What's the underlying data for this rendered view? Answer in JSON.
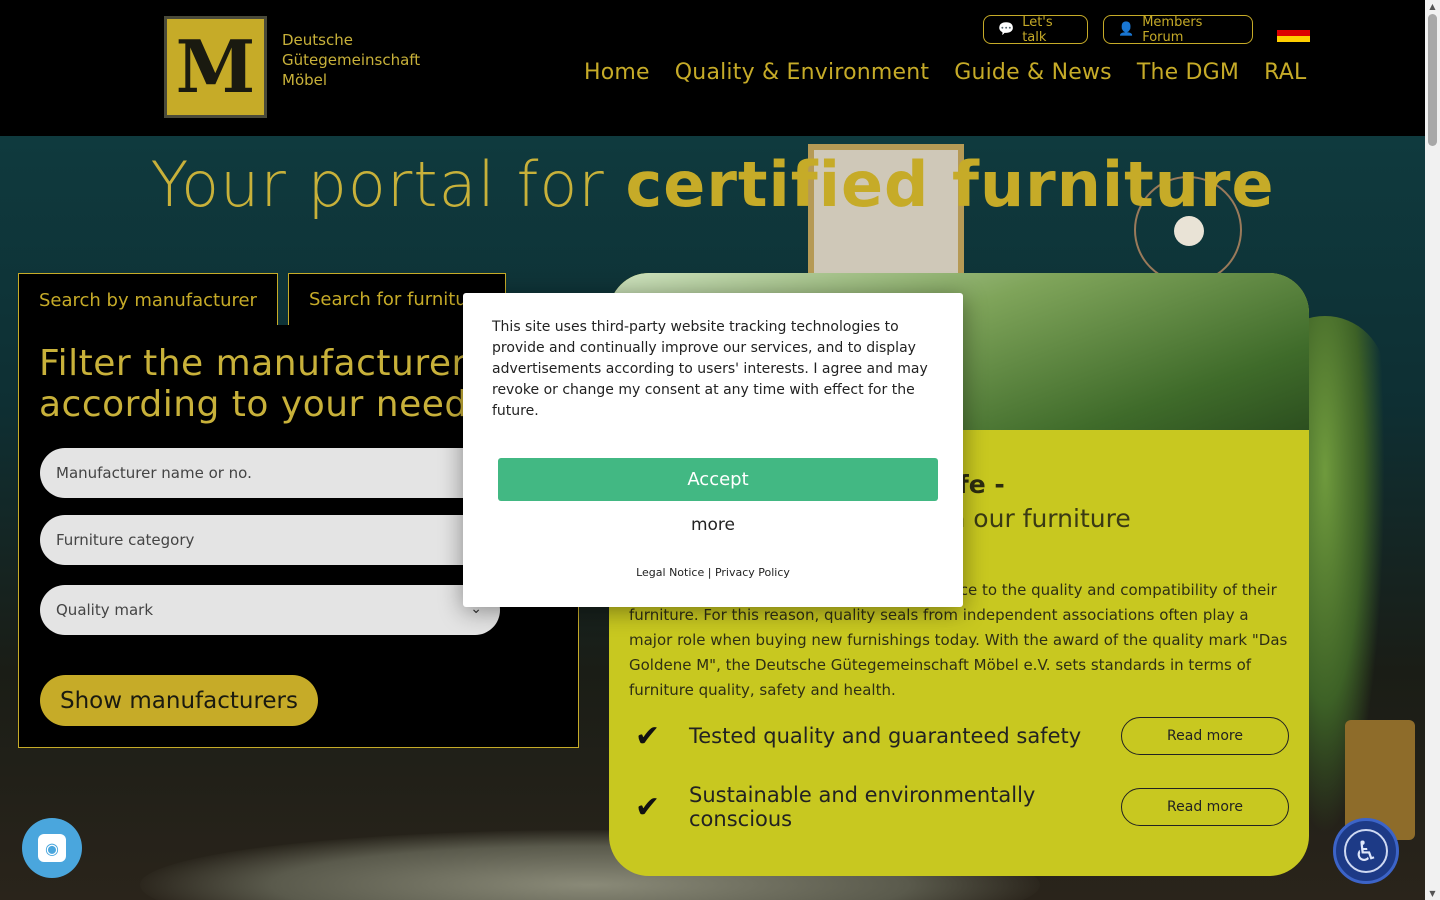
{
  "header": {
    "logo_letter": "M",
    "logo_lines": [
      "Deutsche",
      "Gütegemeinschaft",
      "Möbel"
    ],
    "lets_talk": "Let's talk",
    "members_forum": "Members Forum",
    "language_flag": "de-flag-icon",
    "nav": [
      "Home",
      "Quality & Environment",
      "Guide & News",
      "The DGM",
      "RAL"
    ]
  },
  "hero": {
    "title_plain": "Your portal for ",
    "title_bold": "certified furniture"
  },
  "search": {
    "tabs": [
      "Search by manufacturer",
      "Search for furniture"
    ],
    "panel_title": "Filter the manufacturer list according to your needs",
    "fields": {
      "manufacturer_placeholder": "Manufacturer name or no.",
      "category": "Furniture category",
      "quality_mark": "Quality mark"
    },
    "show_button": "Show manufacturers"
  },
  "card": {
    "heading_line1": "afe -",
    "heading_line2": "m our furniture",
    "body": "ance to the quality and compatibility of their furniture. For this reason, quality seals from independent associations often play a major role when buying new furnishings today. With the award of the quality mark \"Das Goldene M\", the Deutsche Gütegemeinschaft Möbel e.V. sets standards in terms of furniture quality, safety and health.",
    "features": [
      {
        "text": "Tested quality and guaranteed safety",
        "button": "Read more"
      },
      {
        "text": "Sustainable and environmentally conscious",
        "button": "Read more"
      }
    ]
  },
  "consent": {
    "text": "This site uses third-party website tracking technologies to provide and continually improve our services, and to display advertisements according to users' interests. I agree and may revoke or change my consent at any time with effect for the future.",
    "accept": "Accept",
    "more": "more",
    "legal_notice": "Legal Notice",
    "separator": "|",
    "privacy_policy": "Privacy Policy"
  },
  "colors": {
    "brand_gold": "#c6ab28",
    "accept_green": "#42b883",
    "card_yellow": "#c8c820"
  }
}
